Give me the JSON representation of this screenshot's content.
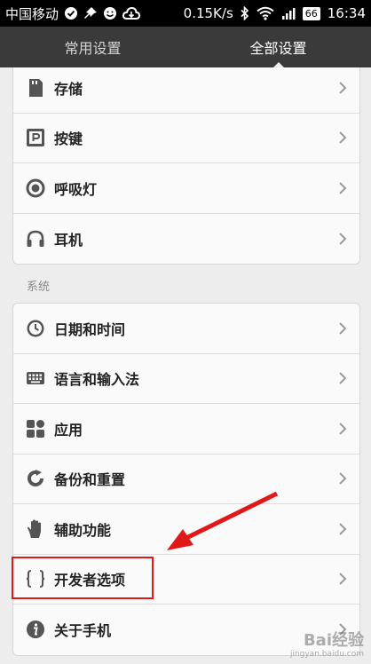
{
  "status_bar": {
    "carrier": "中国移动",
    "speed": "0.15K/s",
    "battery": "66",
    "time": "16:34",
    "icons": [
      "check-circle-icon",
      "pin-icon",
      "smiley-icon",
      "cloud-icon",
      "bluetooth-icon",
      "wifi-icon",
      "signal-icon",
      "battery-icon"
    ]
  },
  "tabs": [
    {
      "label": "常用设置",
      "active": false
    },
    {
      "label": "全部设置",
      "active": true
    }
  ],
  "group1": [
    {
      "label": "存储",
      "icon": "sd-card-icon"
    },
    {
      "label": "按键",
      "icon": "key-button-icon"
    },
    {
      "label": "呼吸灯",
      "icon": "breathing-light-icon"
    },
    {
      "label": "耳机",
      "icon": "headphones-icon"
    }
  ],
  "section_system": "系统",
  "group2": [
    {
      "label": "日期和时间",
      "icon": "clock-icon"
    },
    {
      "label": "语言和输入法",
      "icon": "keyboard-icon"
    },
    {
      "label": "应用",
      "icon": "apps-icon"
    },
    {
      "label": "备份和重置",
      "icon": "reset-icon"
    },
    {
      "label": "辅助功能",
      "icon": "hand-icon"
    },
    {
      "label": "开发者选项",
      "icon": "braces-icon"
    },
    {
      "label": "关于手机",
      "icon": "info-icon"
    }
  ],
  "annotation": {
    "color": "#e01818"
  },
  "watermark": {
    "text": "Bai经验",
    "sub": "jingyan.baidu.com"
  }
}
